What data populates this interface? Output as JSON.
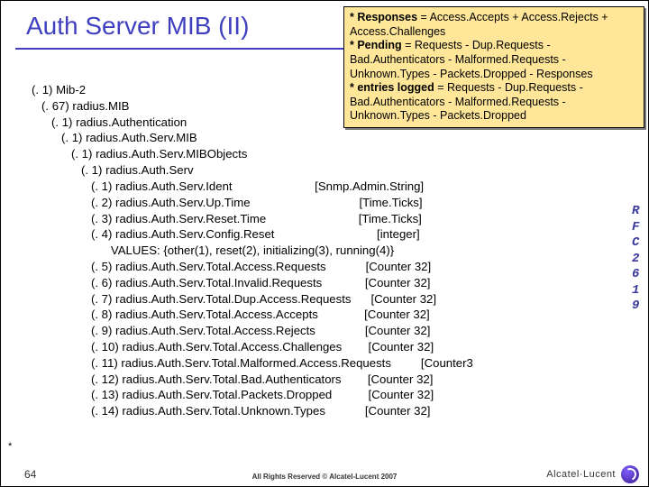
{
  "title": "Auth Server MIB (II)",
  "note": {
    "l1a": "* Responses",
    "l1b": " = Access.Accepts + Access.Rejects + Access.Challenges",
    "l2a": "* Pending",
    "l2b": " = Requests - Dup.Requests - Bad.Authenticators - Malformed.Requests - Unknown.Types - Packets.Dropped - Responses",
    "l3a": "* entries logged",
    "l3b": " = Requests - Dup.Requests -Bad.Authenticators - Malformed.Requests - Unknown.Types - Packets.Dropped"
  },
  "tree": "(. 1) Mib-2\n   (. 67) radius.MIB\n      (. 1) radius.Authentication\n         (. 1) radius.Auth.Serv.MIB\n            (. 1) radius.Auth.Serv.MIBObjects\n               (. 1) radius.Auth.Serv\n                  (. 1) radius.Auth.Serv.Ident                         [Snmp.Admin.String]\n                  (. 2) radius.Auth.Serv.Up.Time                                 [Time.Ticks]\n                  (. 3) radius.Auth.Serv.Reset.Time                            [Time.Ticks]\n                  (. 4) radius.Auth.Serv.Config.Reset                               [integer]\n                        VALUES: {other(1), reset(2), initializing(3), running(4)}\n                  (. 5) radius.Auth.Serv.Total.Access.Requests            [Counter 32]\n                  (. 6) radius.Auth.Serv.Total.Invalid.Requests             [Counter 32]\n                  (. 7) radius.Auth.Serv.Total.Dup.Access.Requests      [Counter 32]\n                  (. 8) radius.Auth.Serv.Total.Access.Accepts              [Counter 32]\n                  (. 9) radius.Auth.Serv.Total.Access.Rejects               [Counter 32]\n                  (. 10) radius.Auth.Serv.Total.Access.Challenges        [Counter 32]\n                  (. 11) radius.Auth.Serv.Total.Malformed.Access.Requests         [Counter3\n                  (. 12) radius.Auth.Serv.Total.Bad.Authenticators        [Counter 32]\n                  (. 13) radius.Auth.Serv.Total.Packets.Dropped           [Counter 32]\n                  (. 14) radius.Auth.Serv.Total.Unknown.Types            [Counter 32]",
  "side": [
    "R",
    "F",
    "C",
    "",
    "2",
    "6",
    "1",
    "9"
  ],
  "asterisk": "*",
  "footer": {
    "page": "64",
    "copy": "All Rights Reserved © Alcatel-Lucent 2007",
    "brand": "Alcatel·Lucent"
  }
}
